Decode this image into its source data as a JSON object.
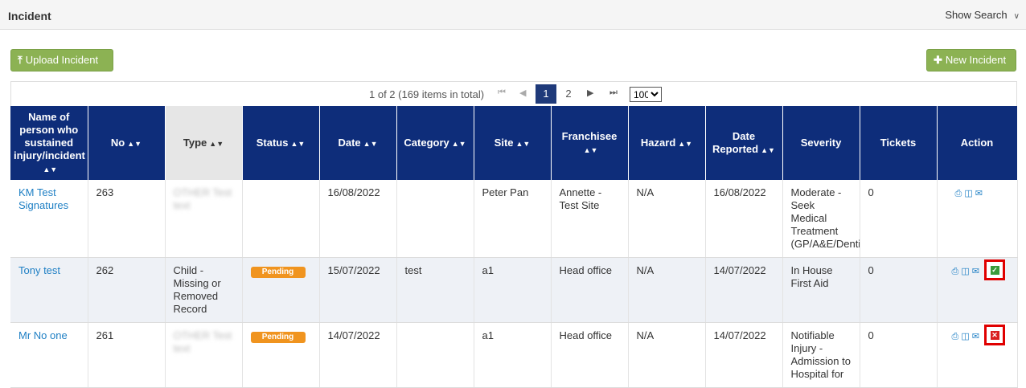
{
  "header": {
    "title": "Incident",
    "show_search": "Show Search"
  },
  "toolbar": {
    "upload_label": "Upload Incident",
    "new_label": "New Incident"
  },
  "pager": {
    "info": "1 of 2 (169 items in total)",
    "pages": [
      "1",
      "2"
    ],
    "current_page": "1",
    "page_size": "100"
  },
  "columns": [
    "Name of person who sustained injury/incident",
    "No",
    "Type",
    "Status",
    "Date",
    "Category",
    "Site",
    "Franchisee",
    "Hazard",
    "Date Reported",
    "Severity",
    "Tickets",
    "Action"
  ],
  "rows": [
    {
      "name": "KM Test Signatures",
      "no": "263",
      "type": "OTHER Test text",
      "status": "",
      "date": "16/08/2022",
      "category": "",
      "site": "Peter Pan",
      "franchisee": "Annette - Test Site",
      "hazard": "N/A",
      "date_reported": "16/08/2022",
      "severity": "Moderate - Seek Medical Treatment (GP/A&E/Dentist)",
      "tickets": "0"
    },
    {
      "name": "Tony test",
      "no": "262",
      "type": "Child - Missing or Removed Record",
      "status": "Pending",
      "date": "15/07/2022",
      "category": "test",
      "site": "a1",
      "franchisee": "Head office",
      "hazard": "N/A",
      "date_reported": "14/07/2022",
      "severity": "In House First Aid",
      "tickets": "0",
      "action_mark": "approve"
    },
    {
      "name": "Mr No one",
      "no": "261",
      "type": "OTHER Test text",
      "status": "Pending",
      "date": "14/07/2022",
      "category": "",
      "site": "a1",
      "franchisee": "Head office",
      "hazard": "N/A",
      "date_reported": "14/07/2022",
      "severity": "Notifiable Injury - Admission to Hospital for",
      "tickets": "0",
      "action_mark": "reject"
    }
  ],
  "colors": {
    "header_bg": "#0e2d7a",
    "button_green": "#8cb253",
    "pending": "#f0941f",
    "link": "#1e7fc4"
  }
}
